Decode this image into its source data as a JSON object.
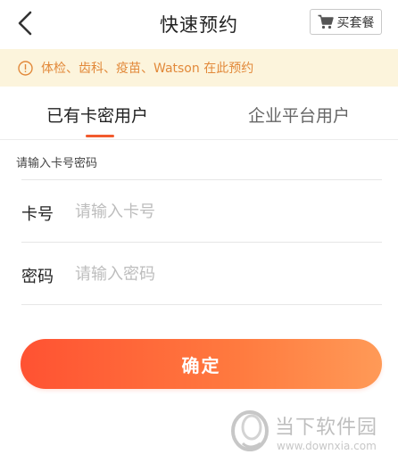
{
  "header": {
    "title": "快速预约",
    "back_icon": "chevron-left-icon",
    "buy_button_label": "买套餐",
    "buy_button_icon": "cart-icon"
  },
  "notice": {
    "icon": "info-icon",
    "text": "体检、齿科、疫苗、Watson 在此预约",
    "background_color": "#fcf4dc",
    "text_color": "#e2893a"
  },
  "tabs": [
    {
      "label": "已有卡密用户",
      "active": true
    },
    {
      "label": "企业平台用户",
      "active": false
    }
  ],
  "form": {
    "section_label": "请输入卡号密码",
    "card": {
      "label": "卡号",
      "placeholder": "请输入卡号",
      "value": ""
    },
    "password": {
      "label": "密码",
      "placeholder": "请输入密码",
      "value": ""
    },
    "submit_label": "确定"
  },
  "colors": {
    "accent": "#f25a2d",
    "button_gradient_start": "#ff5232",
    "button_gradient_end": "#ff9a57"
  },
  "watermark": {
    "brand": "当下软件园",
    "url": "www.downxia.com",
    "icon": "downxia-logo-icon"
  }
}
